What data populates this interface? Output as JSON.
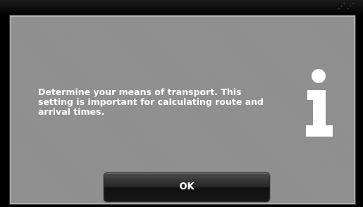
{
  "dialog": {
    "message": "Determine your means of transport. This setting is important for calculating route and arrival times.",
    "icon": "info-icon",
    "ok_label": "OK"
  },
  "colors": {
    "dialog_background": "#8e8e8e",
    "text": "#ffffff",
    "button_background": "#1f1f1f"
  }
}
